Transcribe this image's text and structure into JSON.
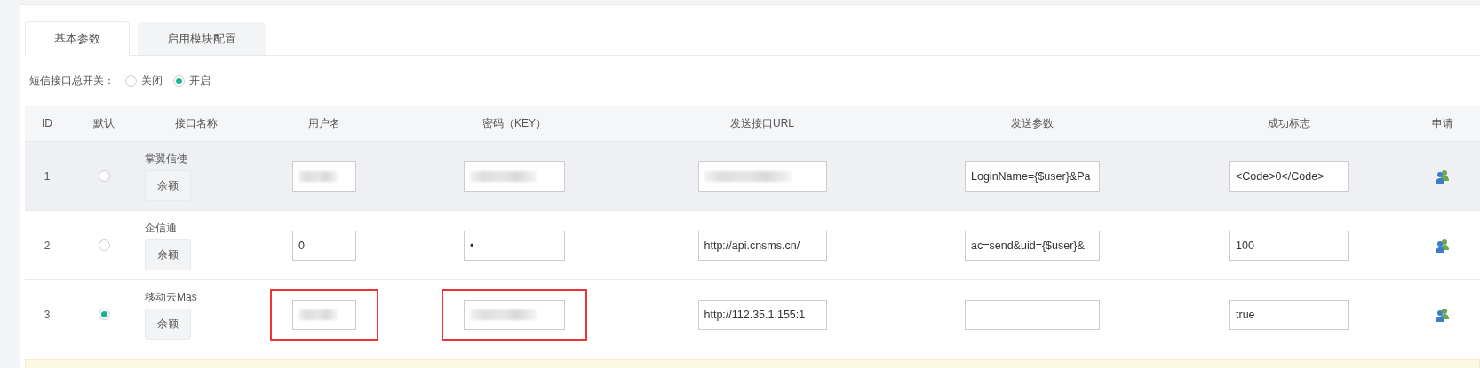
{
  "tabs": [
    {
      "label": "基本参数",
      "selected": true
    },
    {
      "label": "启用模块配置",
      "selected": false
    }
  ],
  "sms_switch": {
    "label": "短信接口总开关：",
    "options": [
      {
        "label": "关闭",
        "selected": false
      },
      {
        "label": "开启",
        "selected": true
      }
    ]
  },
  "table": {
    "columns": [
      "ID",
      "默认",
      "接口名称",
      "用户名",
      "密码（KEY）",
      "发送接口URL",
      "发送参数",
      "成功标志",
      "申请"
    ],
    "rows": [
      {
        "id": "1",
        "hovered": true,
        "default_selected": false,
        "name": "掌翼信使",
        "balance_button": "余额",
        "fields": [
          {
            "redacted": true,
            "flagged": false
          },
          {
            "redacted": true,
            "flagged": false
          },
          {
            "redacted": true,
            "flagged": false
          },
          {
            "value": "LoginName={$user}&Pa",
            "redacted": false,
            "flagged": false
          },
          {
            "value": "<Code>0</Code>",
            "redacted": false,
            "flagged": false
          }
        ]
      },
      {
        "id": "2",
        "hovered": false,
        "default_selected": false,
        "name": "企信通",
        "balance_button": "余额",
        "fields": [
          {
            "value": "0",
            "redacted": false,
            "flagged": false
          },
          {
            "value": "•",
            "redacted": false,
            "flagged": false
          },
          {
            "value": "http://api.cnsms.cn/",
            "redacted": false,
            "flagged": false
          },
          {
            "value": "ac=send&uid={$user}&",
            "redacted": false,
            "flagged": false
          },
          {
            "value": "100",
            "redacted": false,
            "flagged": false
          }
        ]
      },
      {
        "id": "3",
        "hovered": false,
        "default_selected": true,
        "name": "移动云Mas",
        "balance_button": "余额",
        "fields": [
          {
            "redacted": true,
            "flagged": true
          },
          {
            "redacted": true,
            "flagged": true
          },
          {
            "value": "http://112.35.1.155:1",
            "redacted": false,
            "flagged": false
          },
          {
            "redacted": false,
            "flagged": false
          },
          {
            "value": "true",
            "redacted": false,
            "flagged": false
          }
        ]
      }
    ]
  }
}
